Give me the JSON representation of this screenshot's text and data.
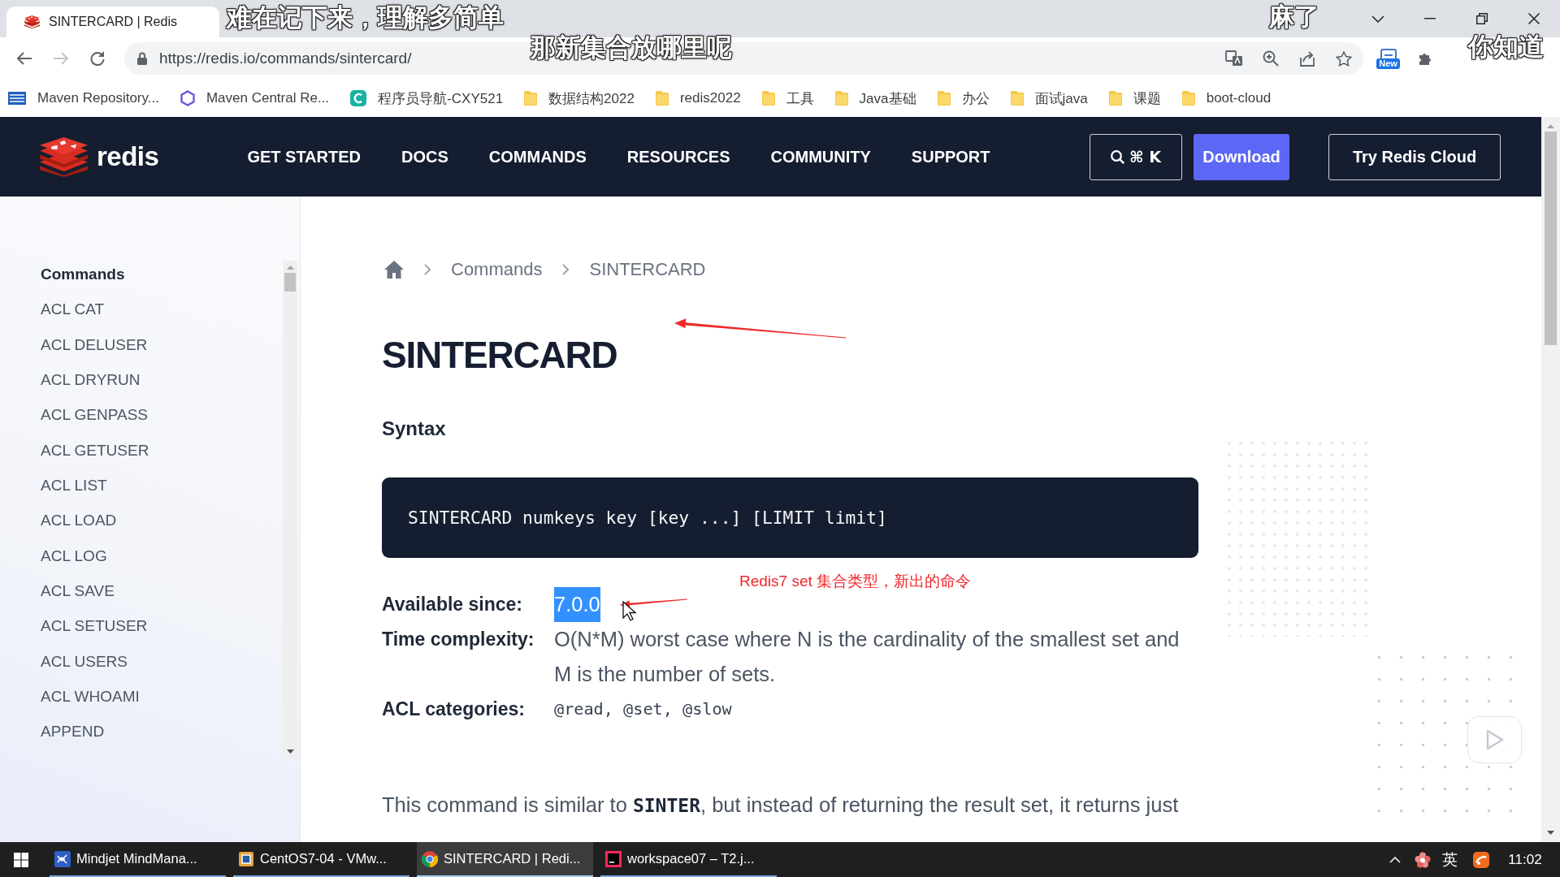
{
  "browser": {
    "tab": {
      "title": "SINTERCARD | Redis",
      "selected": true
    },
    "nav_buttons": [
      {
        "kind": "back",
        "disabled": false
      },
      {
        "kind": "forward",
        "disabled": true
      },
      {
        "kind": "reload",
        "disabled": false
      }
    ],
    "url": "https://redis.io/commands/sintercard/",
    "extension_badge": "New",
    "bookmarks": [
      {
        "kind": "mvn",
        "label": "Maven Repository..."
      },
      {
        "kind": "hexagon",
        "label": "Maven Central Re..."
      },
      {
        "kind": "c-logo",
        "label": "程序员导航-CXY521"
      },
      {
        "kind": "folder",
        "label": "数据结构2022"
      },
      {
        "kind": "folder",
        "label": "redis2022"
      },
      {
        "kind": "folder",
        "label": "工具"
      },
      {
        "kind": "folder",
        "label": "Java基础"
      },
      {
        "kind": "folder",
        "label": "办公"
      },
      {
        "kind": "folder",
        "label": "面试java"
      },
      {
        "kind": "folder",
        "label": "课题"
      },
      {
        "kind": "folder",
        "label": "boot-cloud"
      }
    ]
  },
  "site_nav": {
    "logo_text": "redis",
    "items": [
      "GET STARTED",
      "DOCS",
      "COMMANDS",
      "RESOURCES",
      "COMMUNITY",
      "SUPPORT"
    ],
    "search_shortcut": "⌘ K",
    "buttons": [
      {
        "kind": "primary",
        "label": "Download"
      },
      {
        "kind": "outline",
        "label": "Try Redis Cloud"
      }
    ]
  },
  "sidebar": {
    "heading": "Commands",
    "items": [
      "ACL CAT",
      "ACL DELUSER",
      "ACL DRYRUN",
      "ACL GENPASS",
      "ACL GETUSER",
      "ACL LIST",
      "ACL LOAD",
      "ACL LOG",
      "ACL SAVE",
      "ACL SETUSER",
      "ACL USERS",
      "ACL WHOAMI",
      "APPEND"
    ]
  },
  "breadcrumb": [
    "Commands",
    "SINTERCARD"
  ],
  "title": "SINTERCARD",
  "syntax": {
    "heading": "Syntax",
    "code": "SINTERCARD numkeys key [key ...] [LIMIT limit]"
  },
  "annotation": "Redis7 set 集合类型，新出的命令",
  "properties": [
    {
      "kind": "text",
      "label": "Available since:",
      "value": "7.0.0",
      "selected": true
    },
    {
      "kind": "text",
      "label": "Time complexity:",
      "value": "O(N*M) worst case where N is the cardinality of the smallest set and M is the number of sets.",
      "selected": false
    },
    {
      "kind": "code",
      "label": "ACL categories:",
      "value": "@read, @set, @slow",
      "selected": false
    }
  ],
  "description": "This command is similar to **SINTER**, but instead of returning the result set, it returns just",
  "taskbar": {
    "items": [
      {
        "kind": "mindjet",
        "label": "Mindjet MindMana...",
        "selected": false
      },
      {
        "kind": "vmware",
        "label": "CentOS7-04 - VMw...",
        "selected": false
      },
      {
        "kind": "chrome",
        "label": "SINTERCARD | Redi...",
        "selected": true
      },
      {
        "kind": "intellij",
        "label": "workspace07 – T2.j...",
        "selected": false
      }
    ],
    "ime": "英",
    "clock": "11:02"
  },
  "danmaku": [
    "难在记下来，理解多简单",
    "那新集合放哪里呢",
    "麻了",
    "你知道"
  ]
}
